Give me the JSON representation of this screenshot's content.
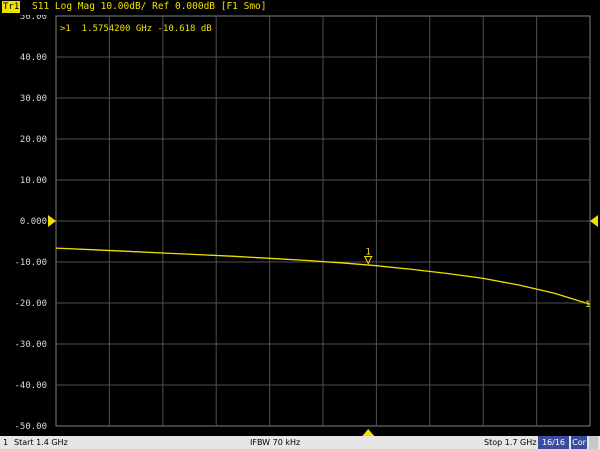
{
  "header": {
    "trace_tag": "Tr1",
    "trace_desc": "S11 Log Mag 10.00dB/ Ref 0.000dB [F1 Smo]"
  },
  "footer": {
    "channel": "1",
    "start": "Start 1.4 GHz",
    "ifbw": "IFBW 70 kHz",
    "stop": "Stop 1.7 GHz",
    "points": "16/16",
    "cor": "Cor"
  },
  "colors": {
    "trace": "#f0e000",
    "grid": "#505050",
    "axis_text": "#d8d8d8",
    "background": "#000000"
  },
  "chart_data": {
    "type": "line",
    "title": "S11 Log Mag 10.00dB/ Ref 0.000dB [F1 Smo]",
    "xlabel": "",
    "ylabel": "",
    "xlim": [
      1.4,
      1.7
    ],
    "ylim": [
      -50,
      50
    ],
    "x_unit": "GHz",
    "y_unit": "dB",
    "grid": true,
    "reference_level": 0,
    "y_ticks": [
      "50.00",
      "40.00",
      "30.00",
      "20.00",
      "10.00",
      "0.000",
      "-10.00",
      "-20.00",
      "-30.00",
      "-40.00",
      "-50.00"
    ],
    "series": [
      {
        "x": [
          1.4,
          1.42,
          1.44,
          1.46,
          1.48,
          1.5,
          1.52,
          1.54,
          1.56,
          1.58,
          1.6,
          1.62,
          1.64,
          1.66,
          1.68,
          1.7
        ],
        "y": [
          -6.6,
          -7.0,
          -7.4,
          -7.8,
          -8.2,
          -8.6,
          -9.1,
          -9.6,
          -10.2,
          -10.9,
          -11.8,
          -12.8,
          -14.0,
          -15.6,
          -17.6,
          -20.3
        ]
      }
    ],
    "marker": {
      "id": "1",
      "x": 1.57542,
      "y": -10.618,
      "readout": ">1  1.5754200 GHz -10.618 dB"
    },
    "end_label": "1"
  }
}
